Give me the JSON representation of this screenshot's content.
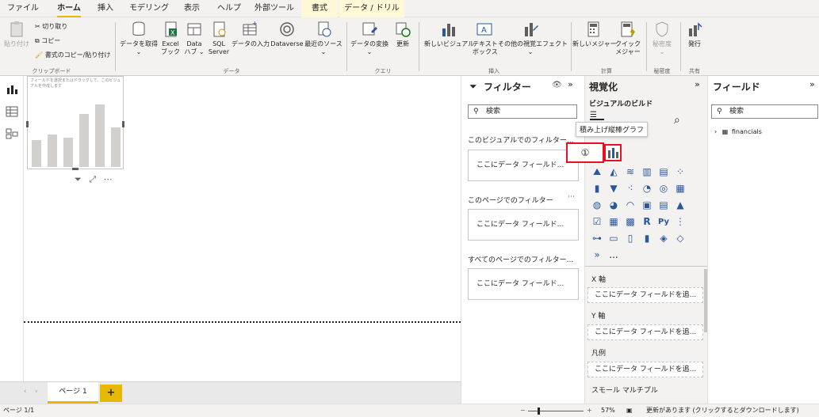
{
  "tabs": [
    {
      "label": "ファイル"
    },
    {
      "label": "ホーム"
    },
    {
      "label": "挿入"
    },
    {
      "label": "モデリング"
    },
    {
      "label": "表示"
    },
    {
      "label": "ヘルプ"
    },
    {
      "label": "外部ツール"
    },
    {
      "label": "書式"
    },
    {
      "label": "データ / ドリル"
    }
  ],
  "ribbon": {
    "paste": "貼り付け",
    "cut": "切り取り",
    "copy": "コピー",
    "format_painter": "書式のコピー/貼り付け",
    "clipboard_group": "クリップボード",
    "get_data": "データを取得",
    "excel_1": "Excel",
    "excel_2": "ブック",
    "datahub_1": "Data",
    "datahub_2": "ハブ",
    "sql_1": "SQL",
    "sql_2": "Server",
    "enter_data": "データの入力",
    "dataverse": "Dataverse",
    "recent_sources": "最近のソース",
    "data_group": "データ",
    "transform": "データの変換",
    "refresh": "更新",
    "query_group": "クエリ",
    "new_visual": "新しいビジュアル",
    "textbox_1": "テキスト",
    "textbox_2": "ボックス",
    "more_visuals": "その他の視覚エフェクト",
    "insert_group": "挿入",
    "new_measure": "新しいメジャー",
    "quick_measure_1": "クイック",
    "quick_measure_2": "メジャー",
    "calc_group": "計算",
    "sensitivity": "秘密度",
    "sensitivity_group": "秘密度",
    "publish": "発行",
    "share_group": "共有"
  },
  "visual_placeholder": "フィールドを選択またはドラッグして、このビジュアルを作成します",
  "filters": {
    "title": "フィルター",
    "search_placeholder": "検索",
    "visual_section": "このビジュアルでのフィルター...",
    "page_section": "このページでのフィルター",
    "all_pages_section": "すべてのページでのフィルター...",
    "well_placeholder": "ここにデータ フィールド..."
  },
  "visualizations": {
    "title": "視覚化",
    "build_label": "ビジュアルのビルド",
    "tooltip": "積み上げ縦棒グラフ",
    "callout_number": "①",
    "more": "...",
    "x_axis": "X 軸",
    "y_axis": "Y 軸",
    "legend": "凡例",
    "small_multiples": "スモール マルチプル",
    "well_placeholder": "ここにデータ フィールドを追..."
  },
  "fields": {
    "title": "フィールド",
    "search_placeholder": "検索",
    "table_name": "financials"
  },
  "page_tab": "ページ 1",
  "add_page": "+",
  "status": {
    "page": "ページ 1/1",
    "zoom": "57%",
    "update": "更新があります (クリックするとダウンロードします)"
  },
  "colors": {
    "accent": "#e6b800",
    "callout_red": "#e81123",
    "icon_blue": "#2b579a"
  }
}
